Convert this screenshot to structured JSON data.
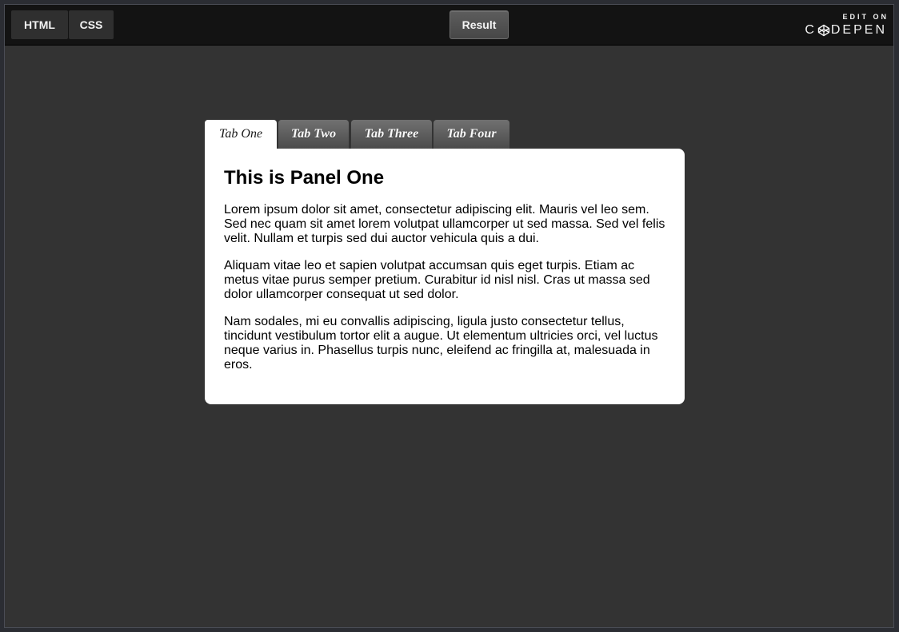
{
  "toolbar": {
    "html_label": "HTML",
    "css_label": "CSS",
    "result_label": "Result",
    "codepen_edit_on": "EDIT ON",
    "codepen_brand_left": "C",
    "codepen_brand_right": "DEPEN"
  },
  "tabs": [
    {
      "label": "Tab One",
      "active": true
    },
    {
      "label": "Tab Two",
      "active": false
    },
    {
      "label": "Tab Three",
      "active": false
    },
    {
      "label": "Tab Four",
      "active": false
    }
  ],
  "panel": {
    "title": "This is Panel One",
    "paragraphs": [
      "Lorem ipsum dolor sit amet, consectetur adipiscing elit. Mauris vel leo sem. Sed nec quam sit amet lorem volutpat ullamcorper ut sed massa. Sed vel felis velit. Nullam et turpis sed dui auctor vehicula quis a dui.",
      "Aliquam vitae leo et sapien volutpat accumsan quis eget turpis. Etiam ac metus vitae purus semper pretium. Curabitur id nisl nisl. Cras ut massa sed dolor ullamcorper consequat ut sed dolor.",
      "Nam sodales, mi eu convallis adipiscing, ligula justo consectetur tellus, tincidunt vestibulum tortor elit a augue. Ut elementum ultricies orci, vel luctus neque varius in. Phasellus turpis nunc, eleifend ac fringilla at, malesuada in eros."
    ]
  },
  "colors": {
    "background": "#333333",
    "topbar": "#131313",
    "panel": "#ffffff",
    "tab_inactive": "#5e5e5e"
  }
}
